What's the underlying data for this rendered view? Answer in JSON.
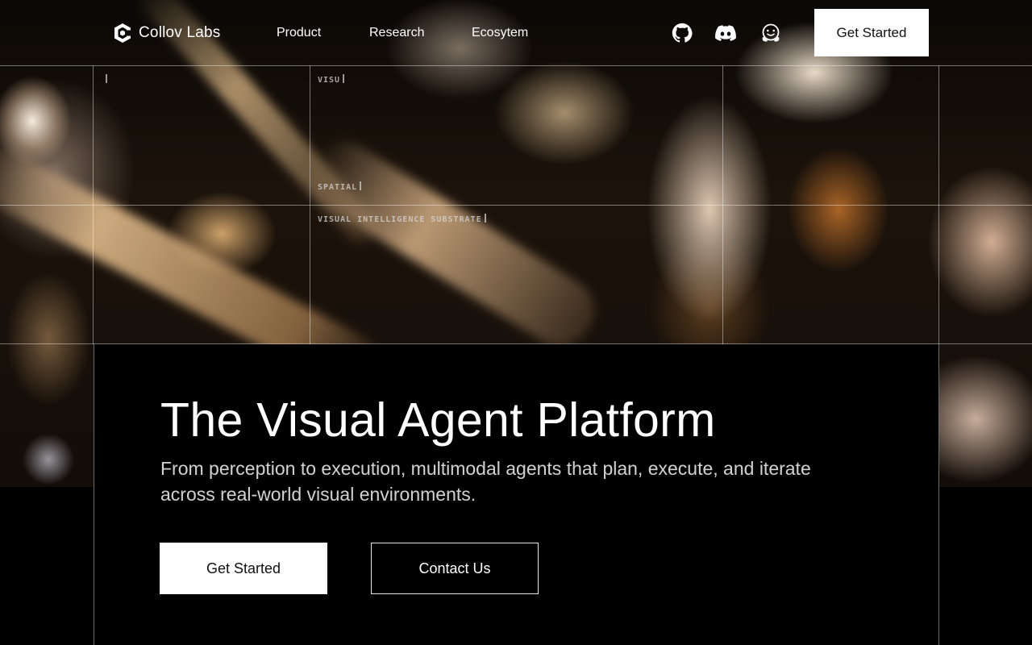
{
  "brand": {
    "name": "Collov Labs",
    "logo_icon": "collov-logo-icon"
  },
  "nav": {
    "links": [
      {
        "label": "Product"
      },
      {
        "label": "Research"
      },
      {
        "label": "Ecosytem"
      }
    ],
    "icons": [
      "github-icon",
      "discord-icon",
      "huggingface-icon"
    ],
    "cta_label": "Get Started"
  },
  "hud": {
    "label_1": "VISU",
    "label_2": "SPATIAL",
    "label_3": "VISUAL INTELLIGENCE SUBSTRATE"
  },
  "hero": {
    "title": "The Visual Agent Platform",
    "subtitle": "From perception to execution, multimodal agents that plan, execute, and iterate across real-world visual environments.",
    "primary_label": "Get Started",
    "secondary_label": "Contact Us"
  },
  "colors": {
    "background": "#000000",
    "button_primary_bg": "#ffffff",
    "text": "#ffffff"
  }
}
